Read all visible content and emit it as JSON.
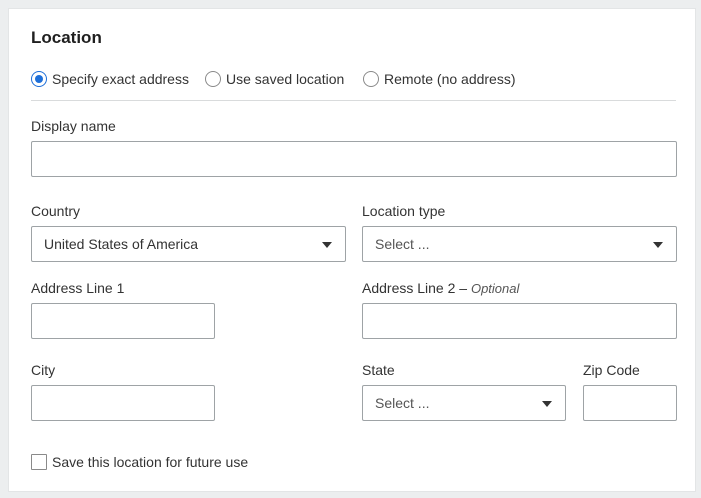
{
  "section": {
    "title": "Location"
  },
  "mode_options": [
    {
      "label": "Specify exact address",
      "checked": true
    },
    {
      "label": "Use saved location",
      "checked": false
    },
    {
      "label": "Remote (no address)",
      "checked": false
    }
  ],
  "fields": {
    "display_name": {
      "label": "Display name",
      "value": ""
    },
    "country": {
      "label": "Country",
      "value": "United States of America"
    },
    "location_type": {
      "label": "Location type",
      "value": "Select ..."
    },
    "address_line_1": {
      "label": "Address Line 1",
      "value": ""
    },
    "address_line_2": {
      "label": "Address Line 2 –",
      "optional": "Optional",
      "value": ""
    },
    "city": {
      "label": "City",
      "value": ""
    },
    "state": {
      "label": "State",
      "value": "Select ..."
    },
    "zip_code": {
      "label": "Zip Code",
      "value": ""
    }
  },
  "save_option": {
    "label": "Save this location for future use",
    "checked": false
  },
  "colors": {
    "accent": "#1e6fd9",
    "border": "#9ea3a6",
    "background": "#eceeef"
  }
}
